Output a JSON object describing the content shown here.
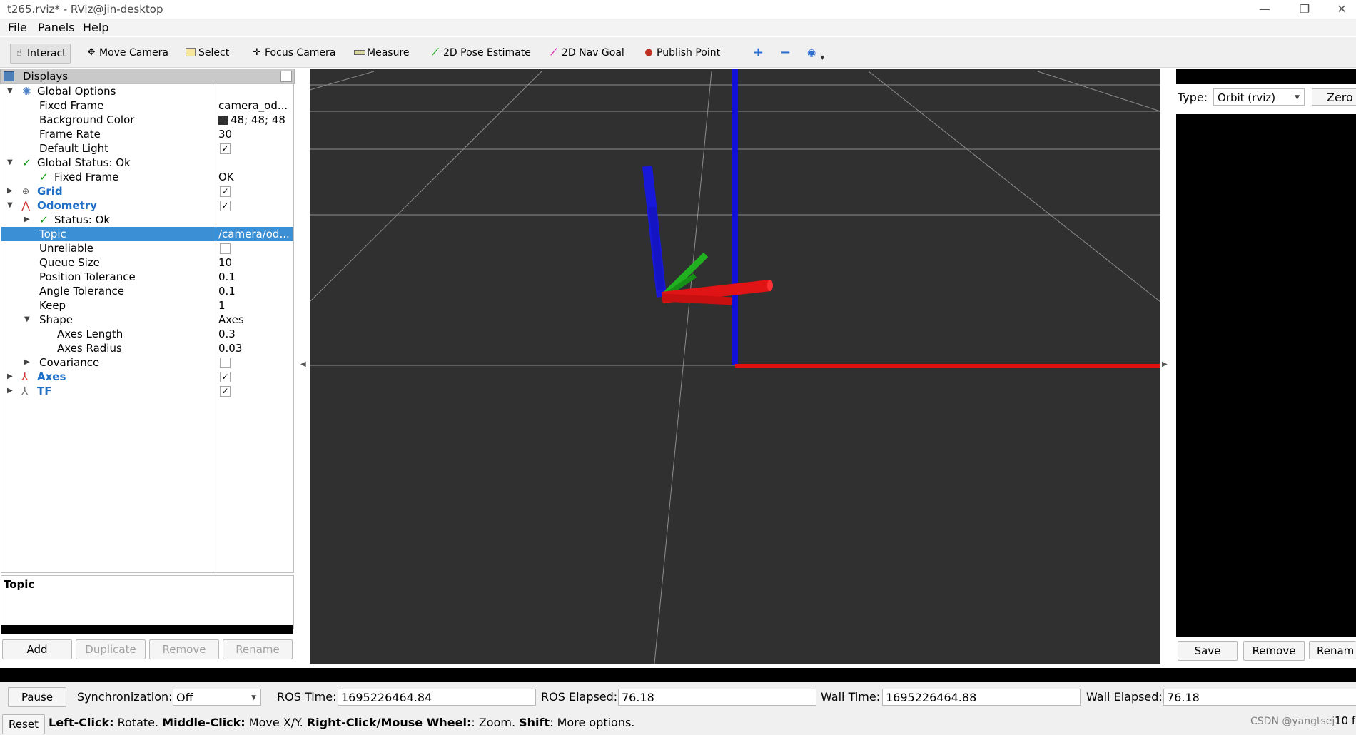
{
  "window": {
    "title": "t265.rviz* - RViz@jin-desktop",
    "minimize_glyph": "—",
    "restore_glyph": "❐",
    "close_glyph": "✕"
  },
  "menu": {
    "items": [
      "File",
      "Panels",
      "Help"
    ]
  },
  "toolbar": {
    "tools": [
      {
        "label": "Interact",
        "icon": "hand-icon"
      },
      {
        "label": "Move Camera",
        "icon": "move-camera-icon"
      },
      {
        "label": "Select",
        "icon": "select-icon"
      },
      {
        "label": "Focus Camera",
        "icon": "focus-camera-icon"
      },
      {
        "label": "Measure",
        "icon": "ruler-icon"
      },
      {
        "label": "2D Pose Estimate",
        "icon": "green-arrow-icon"
      },
      {
        "label": "2D Nav Goal",
        "icon": "pink-arrow-icon"
      },
      {
        "label": "Publish Point",
        "icon": "map-pin-icon"
      }
    ],
    "extra_icons": [
      "plus-icon",
      "minus-icon",
      "eye-icon"
    ]
  },
  "displays": {
    "header": "Displays",
    "rows": [
      {
        "label": "Global Options",
        "value": ""
      },
      {
        "label": "Fixed Frame",
        "value": "camera_od..."
      },
      {
        "label": "Background Color",
        "value": "48; 48; 48"
      },
      {
        "label": "Frame Rate",
        "value": "30"
      },
      {
        "label": "Default Light",
        "value": ""
      },
      {
        "label": "Global Status: Ok",
        "value": ""
      },
      {
        "label": "Fixed Frame",
        "value": "OK"
      },
      {
        "label": "Grid",
        "value": ""
      },
      {
        "label": "Odometry",
        "value": ""
      },
      {
        "label": "Status: Ok",
        "value": ""
      },
      {
        "label": "Topic",
        "value": "/camera/od..."
      },
      {
        "label": "Unreliable",
        "value": ""
      },
      {
        "label": "Queue Size",
        "value": "10"
      },
      {
        "label": "Position Tolerance",
        "value": "0.1"
      },
      {
        "label": "Angle Tolerance",
        "value": "0.1"
      },
      {
        "label": "Keep",
        "value": "1"
      },
      {
        "label": "Shape",
        "value": "Axes"
      },
      {
        "label": "Axes Length",
        "value": "0.3"
      },
      {
        "label": "Axes Radius",
        "value": "0.03"
      },
      {
        "label": "Covariance",
        "value": ""
      },
      {
        "label": "Axes",
        "value": ""
      },
      {
        "label": "TF",
        "value": ""
      }
    ],
    "checkmark": "✓",
    "description_title": "Topic",
    "buttons": [
      "Add",
      "Duplicate",
      "Remove",
      "Rename"
    ]
  },
  "views": {
    "type_label": "Type:",
    "type_value": "Orbit (rviz)",
    "zero_label": "Zero",
    "buttons": [
      "Save",
      "Remove",
      "Renam"
    ]
  },
  "time": {
    "pause_label": "Pause",
    "sync_label": "Synchronization:",
    "sync_value": "Off",
    "ros_time_label": "ROS Time:",
    "ros_time": "1695226464.84",
    "ros_elapsed_label": "ROS Elapsed:",
    "ros_elapsed": "76.18",
    "wall_time_label": "Wall Time:",
    "wall_time": "1695226464.88",
    "wall_elapsed_label": "Wall Elapsed:",
    "wall_elapsed": "76.18"
  },
  "status": {
    "reset_label": "Reset",
    "help": [
      {
        "bold": "Left-Click:",
        "text": " Rotate. "
      },
      {
        "bold": "Middle-Click:",
        "text": " Move X/Y. "
      },
      {
        "bold": "Right-Click/Mouse Wheel:",
        "text": ": Zoom. "
      },
      {
        "bold": "Shift",
        "text": ": More options."
      }
    ],
    "watermark": "CSDN @yangtsej",
    "fps_fragment": "10 f"
  },
  "colors": {
    "selection": "#3b8fd4",
    "viewport_bg": "#303030",
    "axis_red": "#e01010",
    "axis_green": "#18a018",
    "axis_blue": "#1010d8"
  }
}
